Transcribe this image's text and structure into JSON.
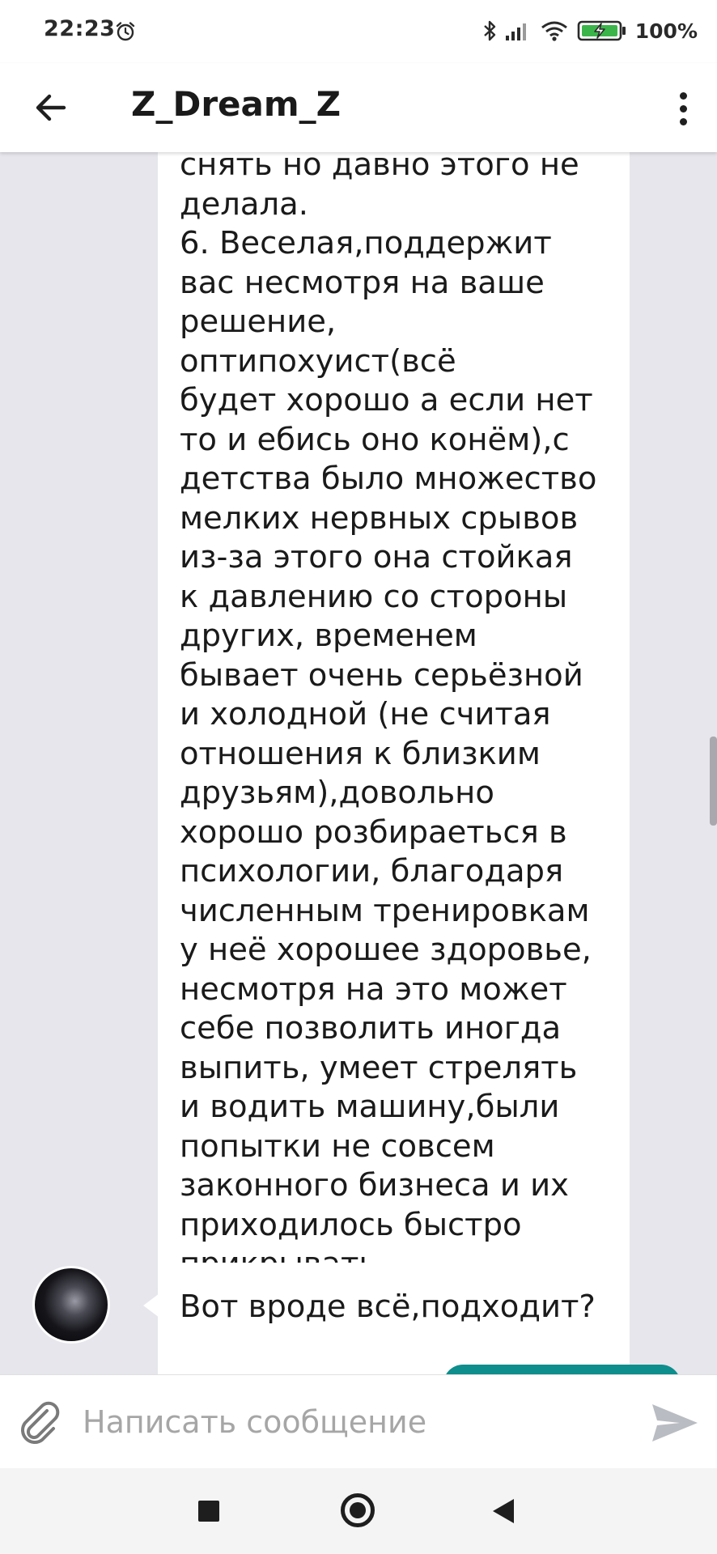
{
  "status_bar": {
    "time": "22:23",
    "battery_percent": "100%",
    "icons": [
      "alarm-icon",
      "bluetooth-icon",
      "signal-icon",
      "wifi-icon",
      "battery-charging-icon"
    ]
  },
  "app_bar": {
    "title": "Z_Dream_Z",
    "back_icon": "arrow-left-icon",
    "menu_icon": "more-vertical-icon"
  },
  "messages": [
    {
      "direction": "incoming",
      "text": "снять но давно этого не\nделала.\n6. Веселая,поддержит\nвас несмотря на ваше\nрешение, оптипохуист(всё\nбудет хорошо а если нет\nто и ебись оно конём),с\nдетства было множество\nмелких нервных срывов\nиз-за этого она стойкая\nк давлению со стороны\nдругих, временем\nбывает очень серьёзной\nи холодной (не считая\nотношения к близким\nдрузьям),довольно\nхорошо розбираеться в\nпсихологии, благодаря\nчисленным тренировкам\nу неё хорошее здоровье,\nнесмотря на это может\nсебе позволить иногда\nвыпить, умеет стрелять\nи водить машину,были\nпопытки не совсем\nзаконного бизнеса и их\nприходилось быстро\nприкрывать."
    },
    {
      "direction": "incoming",
      "text": "Вот вроде всё,подходит?"
    }
  ],
  "composer": {
    "placeholder": "Написать сообщение",
    "value": "",
    "attach_icon": "paperclip-icon",
    "send_icon": "send-icon"
  },
  "colors": {
    "chat_background": "#e6e6ec",
    "bubble_incoming": "#ffffff",
    "bubble_outgoing": "#0e8e8c",
    "send_icon": "#b9bcc2"
  },
  "nav_bar": {
    "icons": [
      "recents-square-icon",
      "home-circle-icon",
      "back-triangle-icon"
    ]
  }
}
